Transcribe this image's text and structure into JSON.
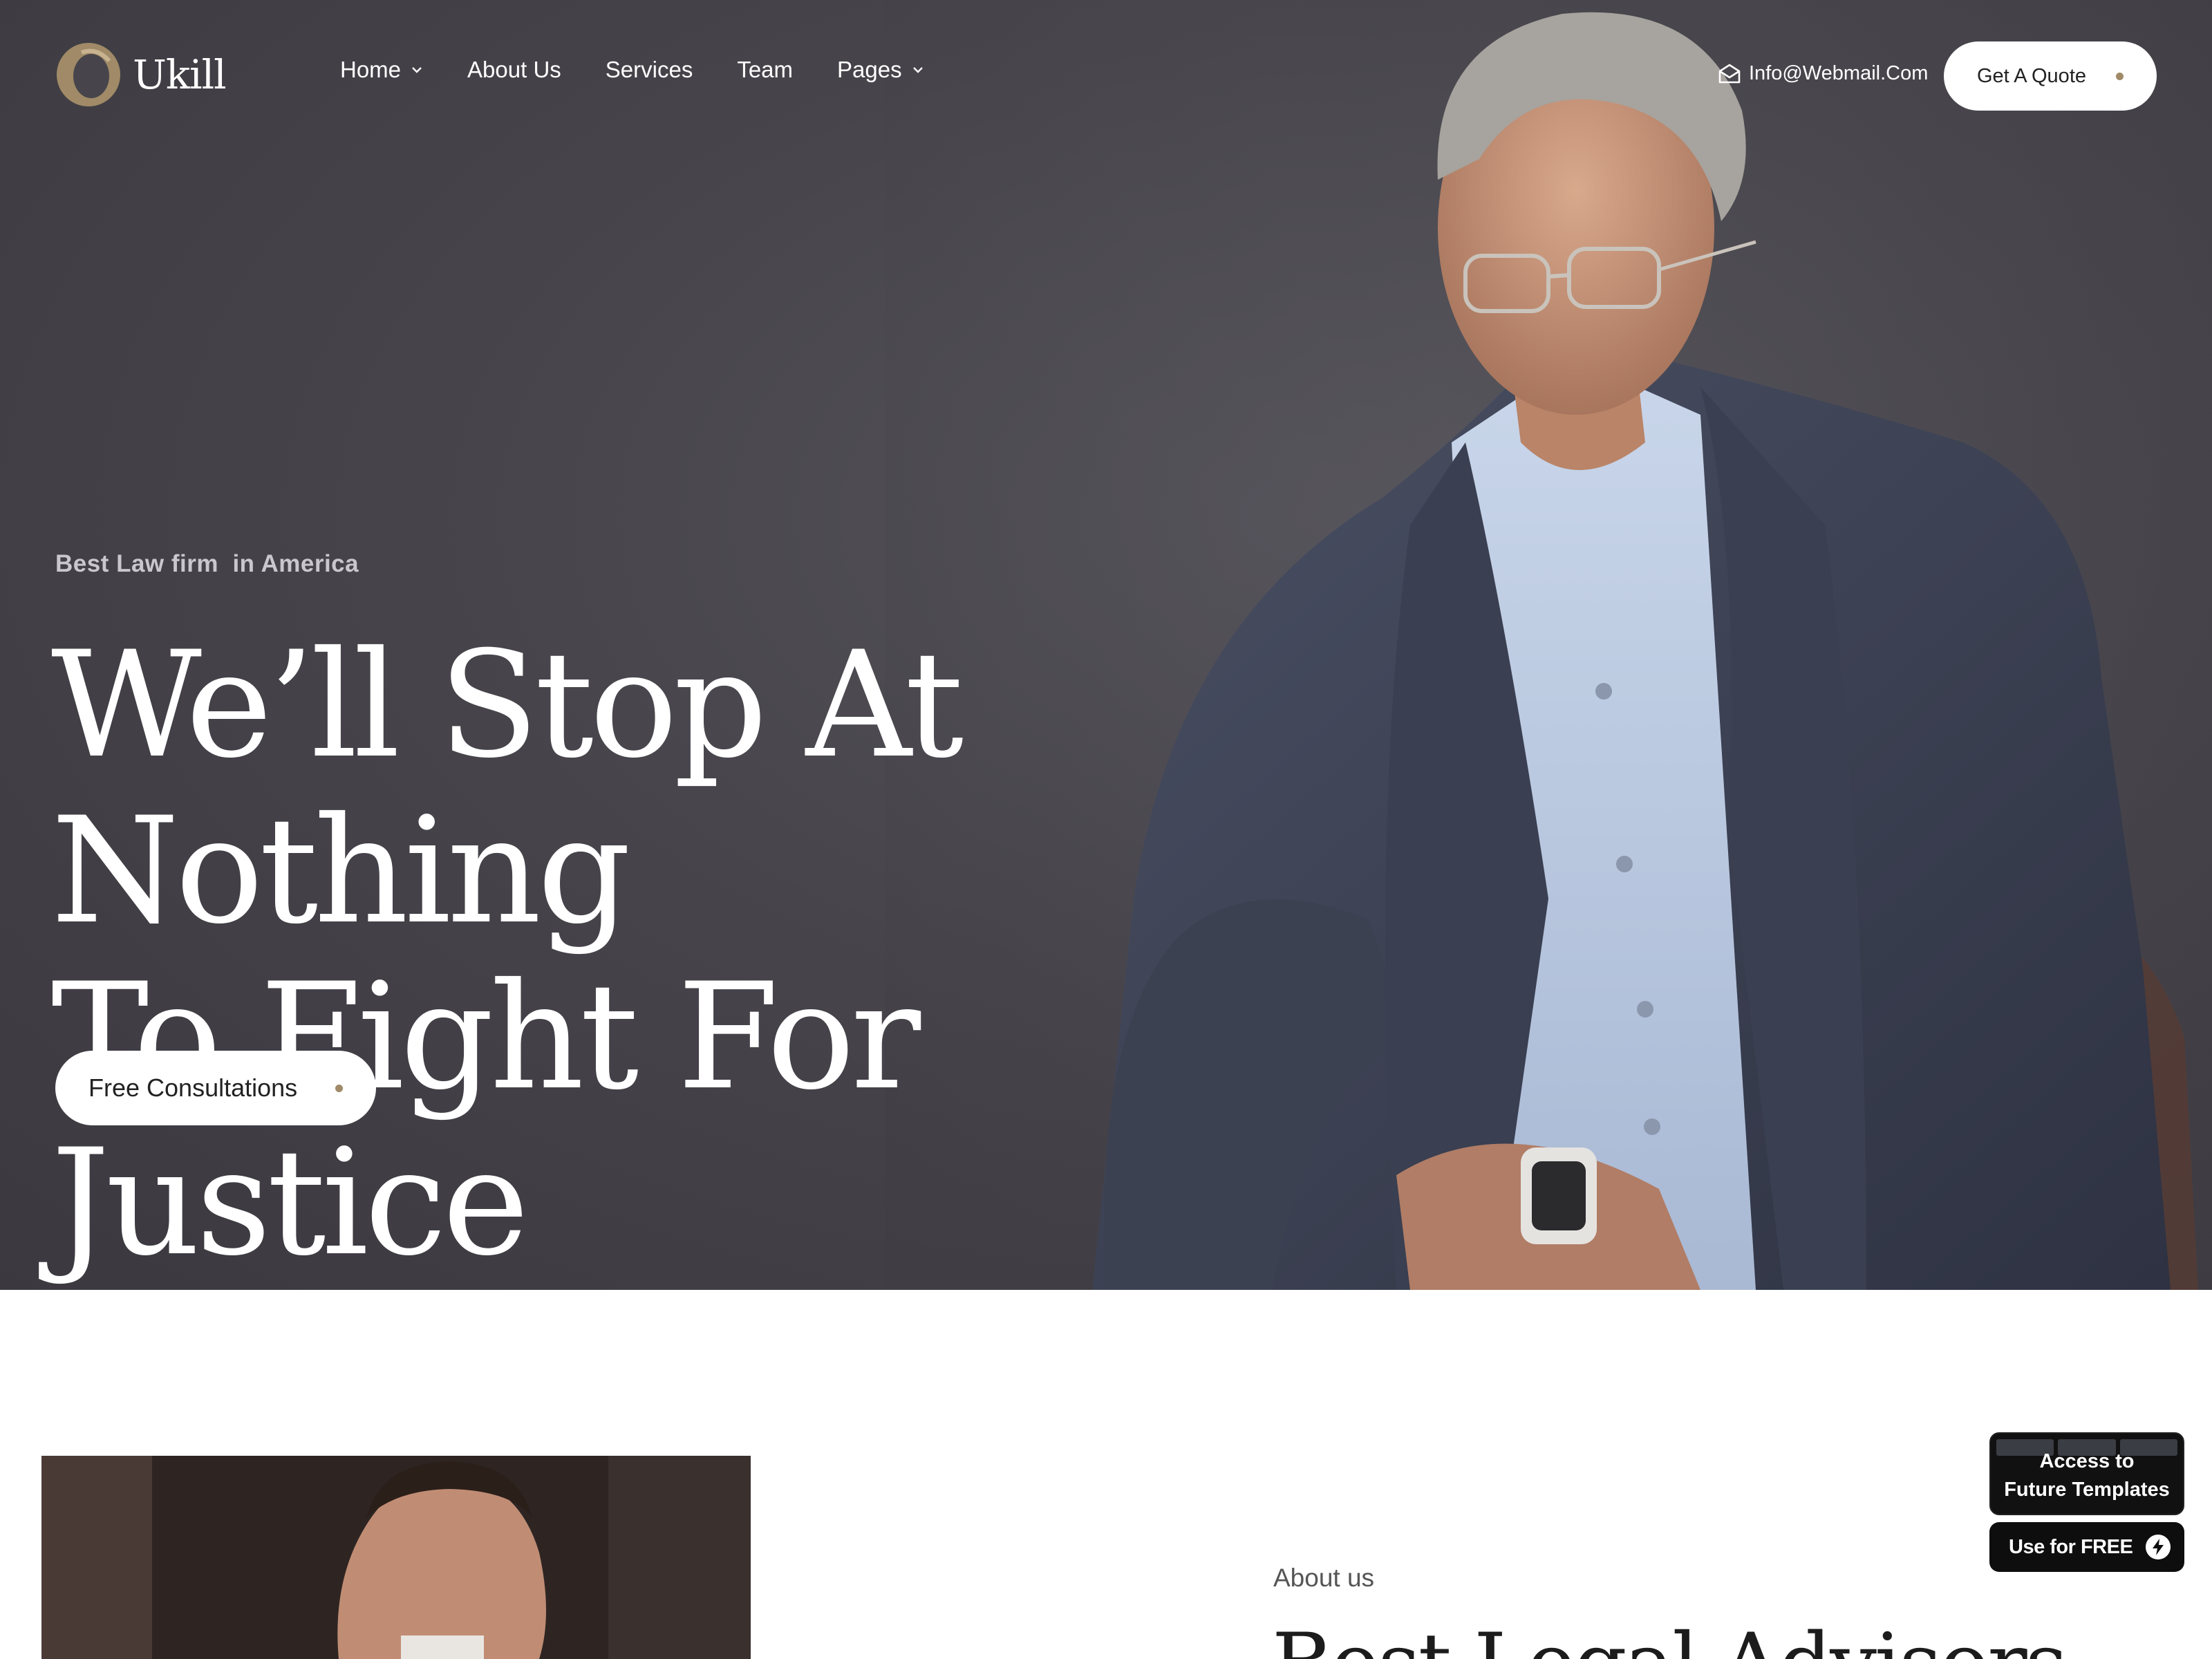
{
  "brand": {
    "name": "Ukill",
    "accent_color": "#a08a67"
  },
  "nav": {
    "items": [
      {
        "label": "Home",
        "has_dropdown": true
      },
      {
        "label": "About Us",
        "has_dropdown": false
      },
      {
        "label": "Services",
        "has_dropdown": false
      },
      {
        "label": "Team",
        "has_dropdown": false
      },
      {
        "label": "Pages",
        "has_dropdown": true
      }
    ],
    "email": "Info@Webmail.Com",
    "email_icon": "mail-icon",
    "cta_label": "Get A Quote"
  },
  "hero": {
    "eyebrow": "Best Law firm  in America",
    "headline_line1": "We’ll Stop At Nothing",
    "headline_line2": "To Fight For Justice",
    "button_label": "Free Consultations",
    "background_color": "#47454b"
  },
  "about": {
    "label": "About us",
    "heading": "Best Legal Advisors"
  },
  "promo": {
    "card_line1": "Access to",
    "card_line2": "Future Templates",
    "button_label": "Use for FREE",
    "button_icon": "bolt-icon"
  }
}
